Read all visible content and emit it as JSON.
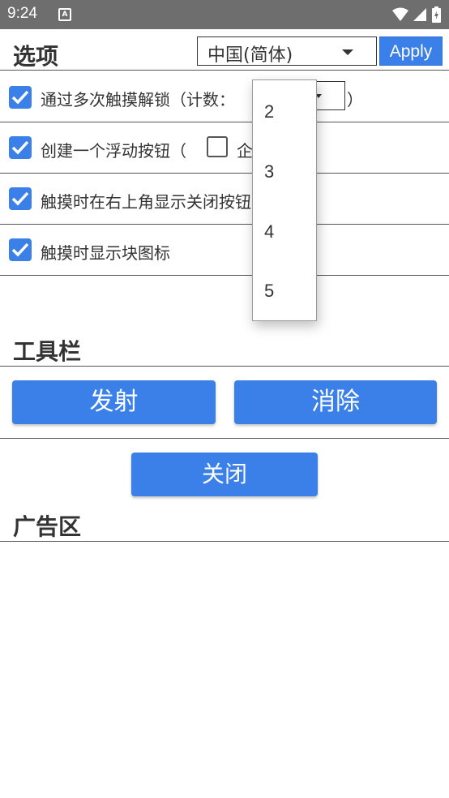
{
  "status_bar": {
    "time": "9:24",
    "notification_icon": "A"
  },
  "options_section": {
    "title": "选项",
    "language_select": {
      "value": "中国(简体)"
    },
    "apply_label": "Apply",
    "rows": [
      {
        "label": "通过多次触摸解锁（计数：",
        "checked": true,
        "suffix": "）"
      },
      {
        "label": "创建一个浮动按钮（",
        "checked": true,
        "inline_checkbox_label": "企"
      },
      {
        "label": "触摸时在右上角显示关闭按钮",
        "checked": true
      },
      {
        "label": "触摸时显示块图标",
        "checked": true
      }
    ],
    "count_dropdown": {
      "options": [
        "2",
        "3",
        "4",
        "5"
      ]
    }
  },
  "toolbar_section": {
    "title": "工具栏",
    "fire_label": "发射",
    "clear_label": "消除",
    "close_label": "关闭"
  },
  "ad_section": {
    "title": "广告区"
  },
  "colors": {
    "accent": "#3b80e8",
    "status_bar": "#6e6e6e"
  }
}
